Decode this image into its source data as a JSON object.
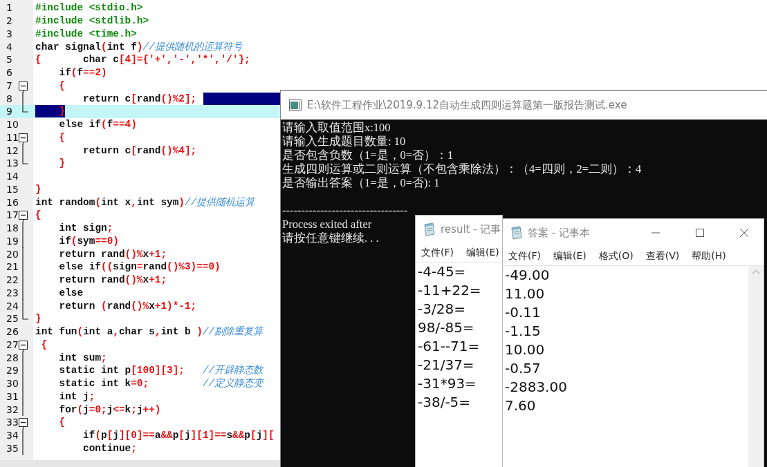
{
  "editor": {
    "lines": [
      {
        "number": "1",
        "code": "#include <stdio.h>",
        "kind": "plain",
        "current": false,
        "selected": false
      },
      {
        "number": "2",
        "code": "#include <stdlib.h>",
        "kind": "plain",
        "current": false,
        "selected": false
      },
      {
        "number": "3",
        "code": "#include <time.h>",
        "kind": "plain",
        "current": false,
        "selected": false
      },
      {
        "number": "4",
        "code": "char signal(int f)//提供随机的运算符号",
        "kind": "plain",
        "current": false,
        "selected": false
      },
      {
        "number": "5",
        "code": "{       char c[4]={'+','-','*','/'};",
        "kind": "plain",
        "current": false,
        "selected": false
      },
      {
        "number": "6",
        "code": "    if(f==2)",
        "kind": "plain",
        "current": false,
        "selected": false
      },
      {
        "number": "7",
        "code": "    {",
        "kind": "fold_start",
        "current": false,
        "selected": false
      },
      {
        "number": "8",
        "code": "        return c[rand()%2];",
        "kind": "fold_body",
        "current": false,
        "selected": true
      },
      {
        "number": "9",
        "code": "    }",
        "kind": "fold_end",
        "current": true,
        "selected": true
      },
      {
        "number": "10",
        "code": "    else if(f==4)",
        "kind": "plain",
        "current": false,
        "selected": false
      },
      {
        "number": "11",
        "code": "    {",
        "kind": "fold_start",
        "current": false,
        "selected": false
      },
      {
        "number": "12",
        "code": "        return c[rand()%4];",
        "kind": "fold_body",
        "current": false,
        "selected": false
      },
      {
        "number": "13",
        "code": "    }",
        "kind": "fold_end",
        "current": false,
        "selected": false
      },
      {
        "number": "14",
        "kind": "plain",
        "current": false,
        "selected": false
      },
      {
        "number": "15",
        "code": "}",
        "kind": "plain",
        "current": false,
        "selected": false
      },
      {
        "number": "16",
        "code": "int random(int x,int sym)//提供随机运算",
        "kind": "plain",
        "current": false,
        "selected": false
      },
      {
        "number": "17",
        "code": "{",
        "kind": "fold_start",
        "current": false,
        "selected": false
      },
      {
        "number": "18",
        "code": "    int sign;",
        "kind": "fold_body",
        "current": false,
        "selected": false
      },
      {
        "number": "19",
        "code": "    if(sym==0)",
        "kind": "fold_body",
        "current": false,
        "selected": false
      },
      {
        "number": "20",
        "code": "    return rand()%x+1;",
        "kind": "fold_body",
        "current": false,
        "selected": false
      },
      {
        "number": "21",
        "code": "    else if((sign=rand()%3)==0)",
        "kind": "fold_body",
        "current": false,
        "selected": false
      },
      {
        "number": "22",
        "code": "    return rand()%x+1;",
        "kind": "fold_body",
        "current": false,
        "selected": false
      },
      {
        "number": "23",
        "code": "    else",
        "kind": "fold_body",
        "current": false,
        "selected": false
      },
      {
        "number": "24",
        "code": "    return (rand()%x+1)*-1;",
        "kind": "fold_body",
        "current": false,
        "selected": false
      },
      {
        "number": "25",
        "code": "}",
        "kind": "fold_end",
        "current": false,
        "selected": false
      },
      {
        "number": "26",
        "code": "int fun(int a,char s,int b )//剔除重复算",
        "kind": "plain",
        "current": false,
        "selected": false
      },
      {
        "number": "27",
        "code": " {",
        "kind": "fold_start",
        "current": false,
        "selected": false
      },
      {
        "number": "28",
        "code": "    int sum;",
        "kind": "fold_body",
        "current": false,
        "selected": false
      },
      {
        "number": "29",
        "code": "    static int p[100][3];   //开辟静态数",
        "kind": "fold_body",
        "current": false,
        "selected": false
      },
      {
        "number": "30",
        "code": "    static int k=0;         //定义静态变",
        "kind": "fold_body",
        "current": false,
        "selected": false
      },
      {
        "number": "31",
        "code": "    int j;",
        "kind": "fold_body",
        "current": false,
        "selected": false
      },
      {
        "number": "32",
        "code": "    for(j=0;j<=k;j++)",
        "kind": "fold_body",
        "current": false,
        "selected": false
      },
      {
        "number": "33",
        "code": "    {",
        "kind": "fold_start",
        "current": false,
        "selected": false
      },
      {
        "number": "34",
        "code": "        if(p[j][0]==a&&p[j][1]==s&&p[j][",
        "kind": "fold_body",
        "current": false,
        "selected": false
      },
      {
        "number": "35",
        "code": "        continue;",
        "kind": "fold_body",
        "current": false,
        "selected": false
      }
    ]
  },
  "console": {
    "title": "E:\\软件工程作业\\2019.9.12自动生成四则运算题第一版报告测试.exe",
    "lines": [
      {
        "text": "请输入取值范围x:100"
      },
      {
        "text": "请输入生成题目数量: 10"
      },
      {
        "text": "是否包含负数（1=是，0=否）：1"
      },
      {
        "text": "生成四则运算或二则运算（不包含乘除法）：（4=四则，2=二则）：4"
      },
      {
        "text": "是否输出答案（1=是，0=否): 1"
      },
      {
        "text": "---------------------------------",
        "blank_before": true
      },
      {
        "text": "Process exited after"
      },
      {
        "text": "请按任意键继续. . ."
      }
    ]
  },
  "notepads": [
    {
      "title": "result - 记事",
      "menu": [
        "文件(F)",
        "编辑(E)"
      ],
      "lines": [
        "-4-45=",
        "-11+22=",
        "-3/28=",
        "98/-85=",
        "-61--71=",
        "-21/37=",
        "-31*93=",
        "-38/-5="
      ]
    },
    {
      "title": "答案 - 记事本",
      "menu": [
        "文件(F)",
        "编辑(E)",
        "格式(O)",
        "查看(V)",
        "帮助(H)"
      ],
      "window_controls": true,
      "scrollbar": true,
      "lines": [
        "-49.00",
        "11.00",
        "-0.11",
        "-1.15",
        "10.00",
        "-0.57",
        "-2883.00",
        "7.60"
      ]
    }
  ]
}
